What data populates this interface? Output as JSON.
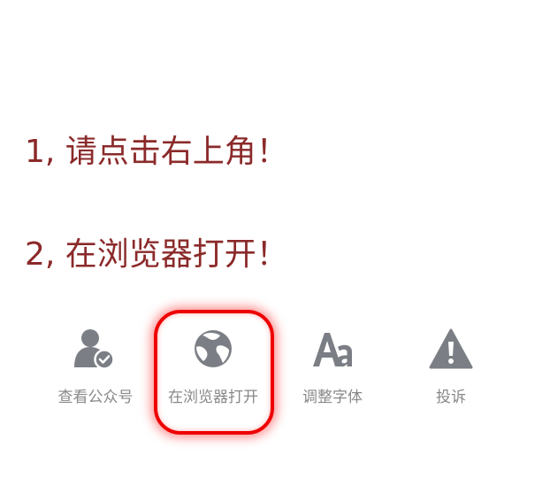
{
  "instructions": {
    "step1": "1, 请点击右上角！",
    "step2": "2, 在浏览器打开！"
  },
  "menu": {
    "items": [
      {
        "label": "查看公众号",
        "icon": "user-check-icon"
      },
      {
        "label": "在浏览器打开",
        "icon": "globe-icon"
      },
      {
        "label": "调整字体",
        "icon": "font-size-icon"
      },
      {
        "label": "投诉",
        "icon": "warning-icon"
      }
    ],
    "highlighted_item": "在浏览器打开"
  },
  "colors": {
    "instruction_text": "#8b2a2a",
    "icon": "#7b7f85",
    "label_text": "#888888",
    "highlight_border": "#ee0000",
    "background": "#ffffff"
  }
}
